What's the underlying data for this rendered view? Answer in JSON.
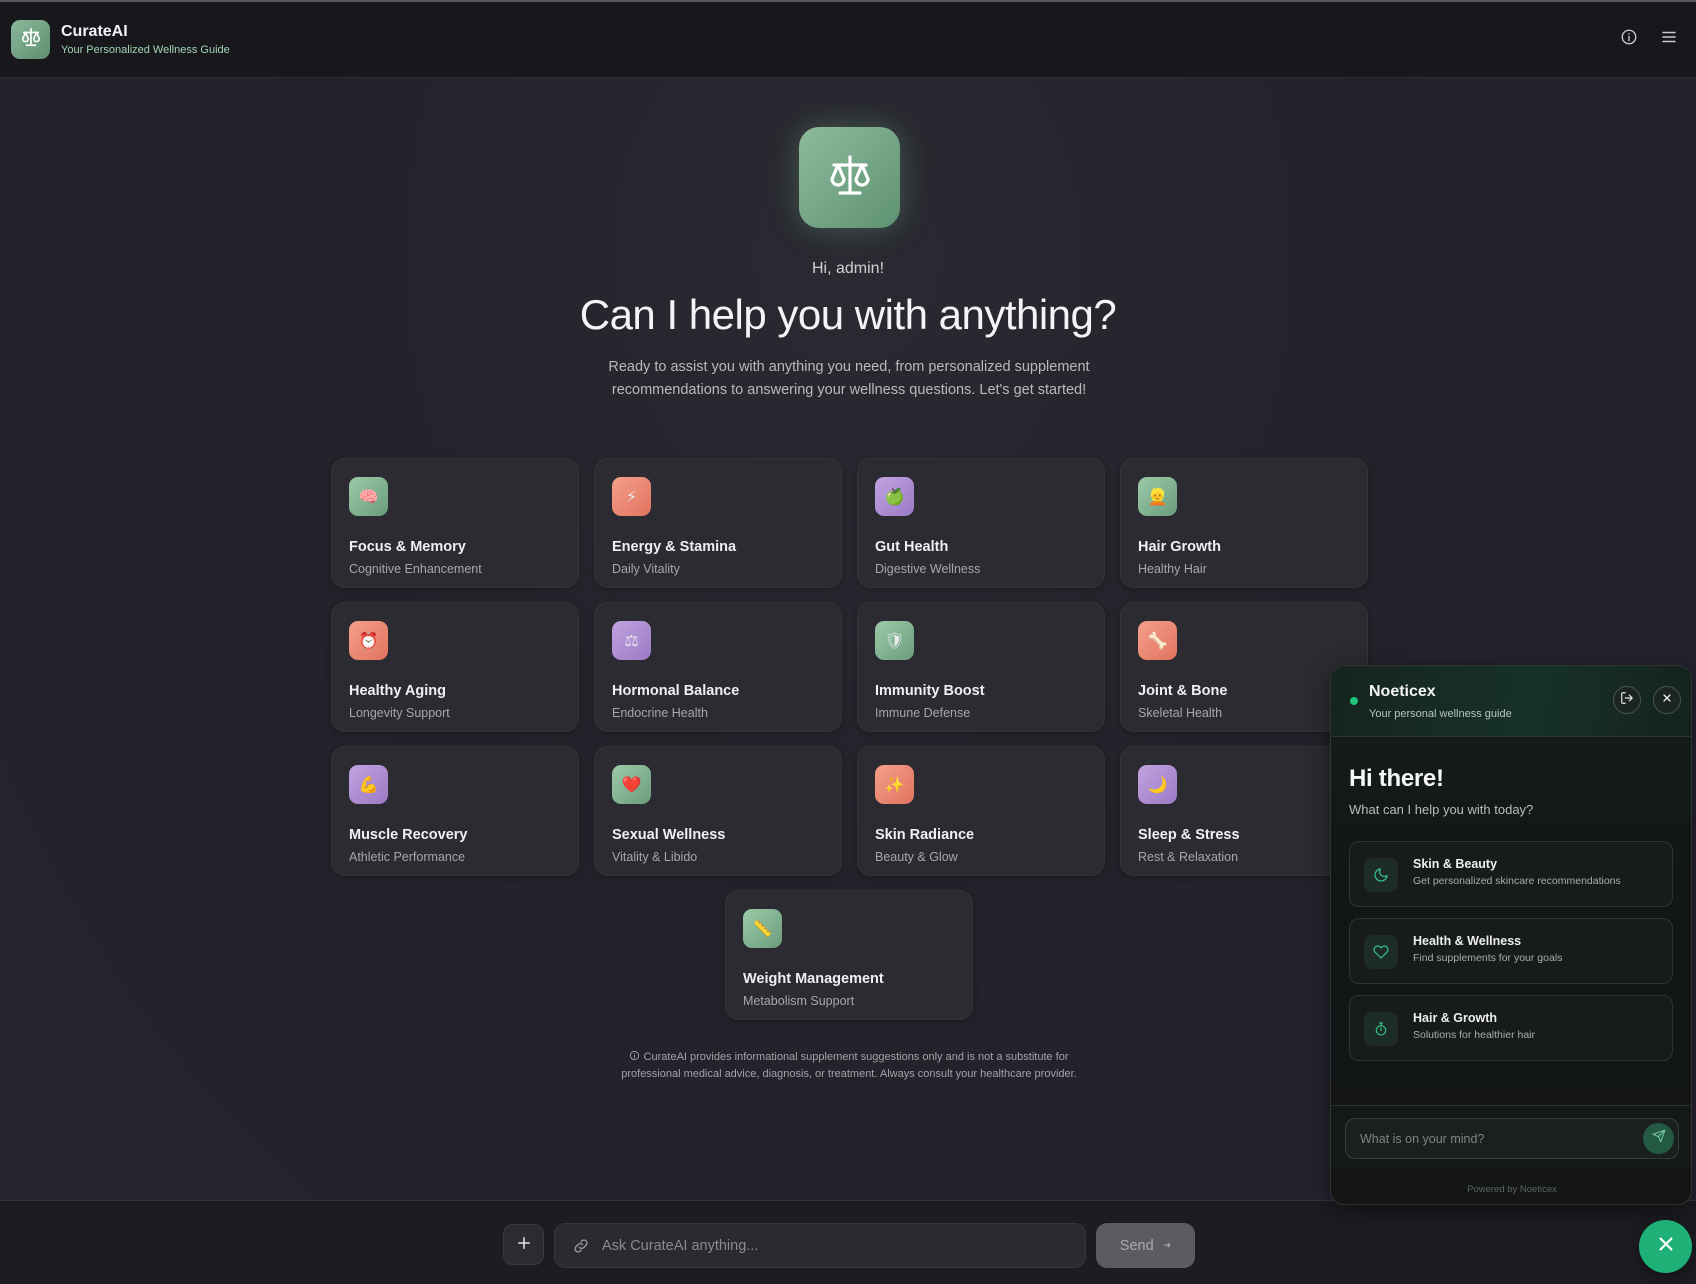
{
  "header": {
    "app_name": "CurateAI",
    "tagline": "Your Personalized Wellness Guide"
  },
  "hero": {
    "greeting": "Hi, admin!",
    "headline": "Can I help you with anything?",
    "intro": "Ready to assist you with anything you need, from personalized supplement recommendations to answering your wellness questions. Let's get started!"
  },
  "categories": [
    {
      "title": "Focus & Memory",
      "subtitle": "Cognitive Enhancement",
      "emoji": "🧠",
      "icon": "brain-icon",
      "color": "green"
    },
    {
      "title": "Energy & Stamina",
      "subtitle": "Daily Vitality",
      "emoji": "⚡",
      "icon": "lightning-icon",
      "color": "coral"
    },
    {
      "title": "Gut Health",
      "subtitle": "Digestive Wellness",
      "emoji": "🍏",
      "icon": "apple-icon",
      "color": "purple"
    },
    {
      "title": "Hair Growth",
      "subtitle": "Healthy Hair",
      "emoji": "👱",
      "icon": "person-hair-icon",
      "color": "green"
    },
    {
      "title": "Healthy Aging",
      "subtitle": "Longevity Support",
      "emoji": "⏰",
      "icon": "clock-icon",
      "color": "coral"
    },
    {
      "title": "Hormonal Balance",
      "subtitle": "Endocrine Health",
      "emoji": "⚖",
      "icon": "balance-scale-icon",
      "color": "purple"
    },
    {
      "title": "Immunity Boost",
      "subtitle": "Immune Defense",
      "emoji": "🛡",
      "icon": "shield-icon",
      "color": "green"
    },
    {
      "title": "Joint & Bone",
      "subtitle": "Skeletal Health",
      "emoji": "🦴",
      "icon": "bone-icon",
      "color": "coral"
    },
    {
      "title": "Muscle Recovery",
      "subtitle": "Athletic Performance",
      "emoji": "💪",
      "icon": "flexed-bicep-icon",
      "color": "purple"
    },
    {
      "title": "Sexual Wellness",
      "subtitle": "Vitality & Libido",
      "emoji": "❤️",
      "icon": "heart-icon",
      "color": "green"
    },
    {
      "title": "Skin Radiance",
      "subtitle": "Beauty & Glow",
      "emoji": "✨",
      "icon": "sparkles-icon",
      "color": "coral"
    },
    {
      "title": "Sleep & Stress",
      "subtitle": "Rest & Relaxation",
      "emoji": "🌙",
      "icon": "crescent-moon-icon",
      "color": "purple"
    },
    {
      "title": "Weight Management",
      "subtitle": "Metabolism Support",
      "emoji": "📏",
      "icon": "ruler-icon",
      "color": "green"
    }
  ],
  "disclaimer": "CurateAI provides informational supplement suggestions only and is not a substitute for professional medical advice, diagnosis, or treatment. Always consult your healthcare provider.",
  "composer": {
    "placeholder": "Ask CurateAI anything...",
    "send_label": "Send",
    "send_arrow": "➜"
  },
  "chat": {
    "name": "Noeticex",
    "tagline": "Your personal wellness guide",
    "hi": "Hi there!",
    "hi_sub": "What can I help you with today?",
    "options": [
      {
        "title": "Skin & Beauty",
        "subtitle": "Get personalized skincare recommendations",
        "icon": "moon-icon"
      },
      {
        "title": "Health & Wellness",
        "subtitle": "Find supplements for your goals",
        "icon": "heart-outline-icon"
      },
      {
        "title": "Hair & Growth",
        "subtitle": "Solutions for healthier hair",
        "icon": "timer-icon"
      }
    ],
    "input_placeholder": "What is on your mind?",
    "powered_by": "Powered by Noeticex"
  },
  "colors": {
    "accent": "#1fb077",
    "status_online": "#22c37a",
    "background": "#23222a",
    "card": "#2b2b31"
  }
}
